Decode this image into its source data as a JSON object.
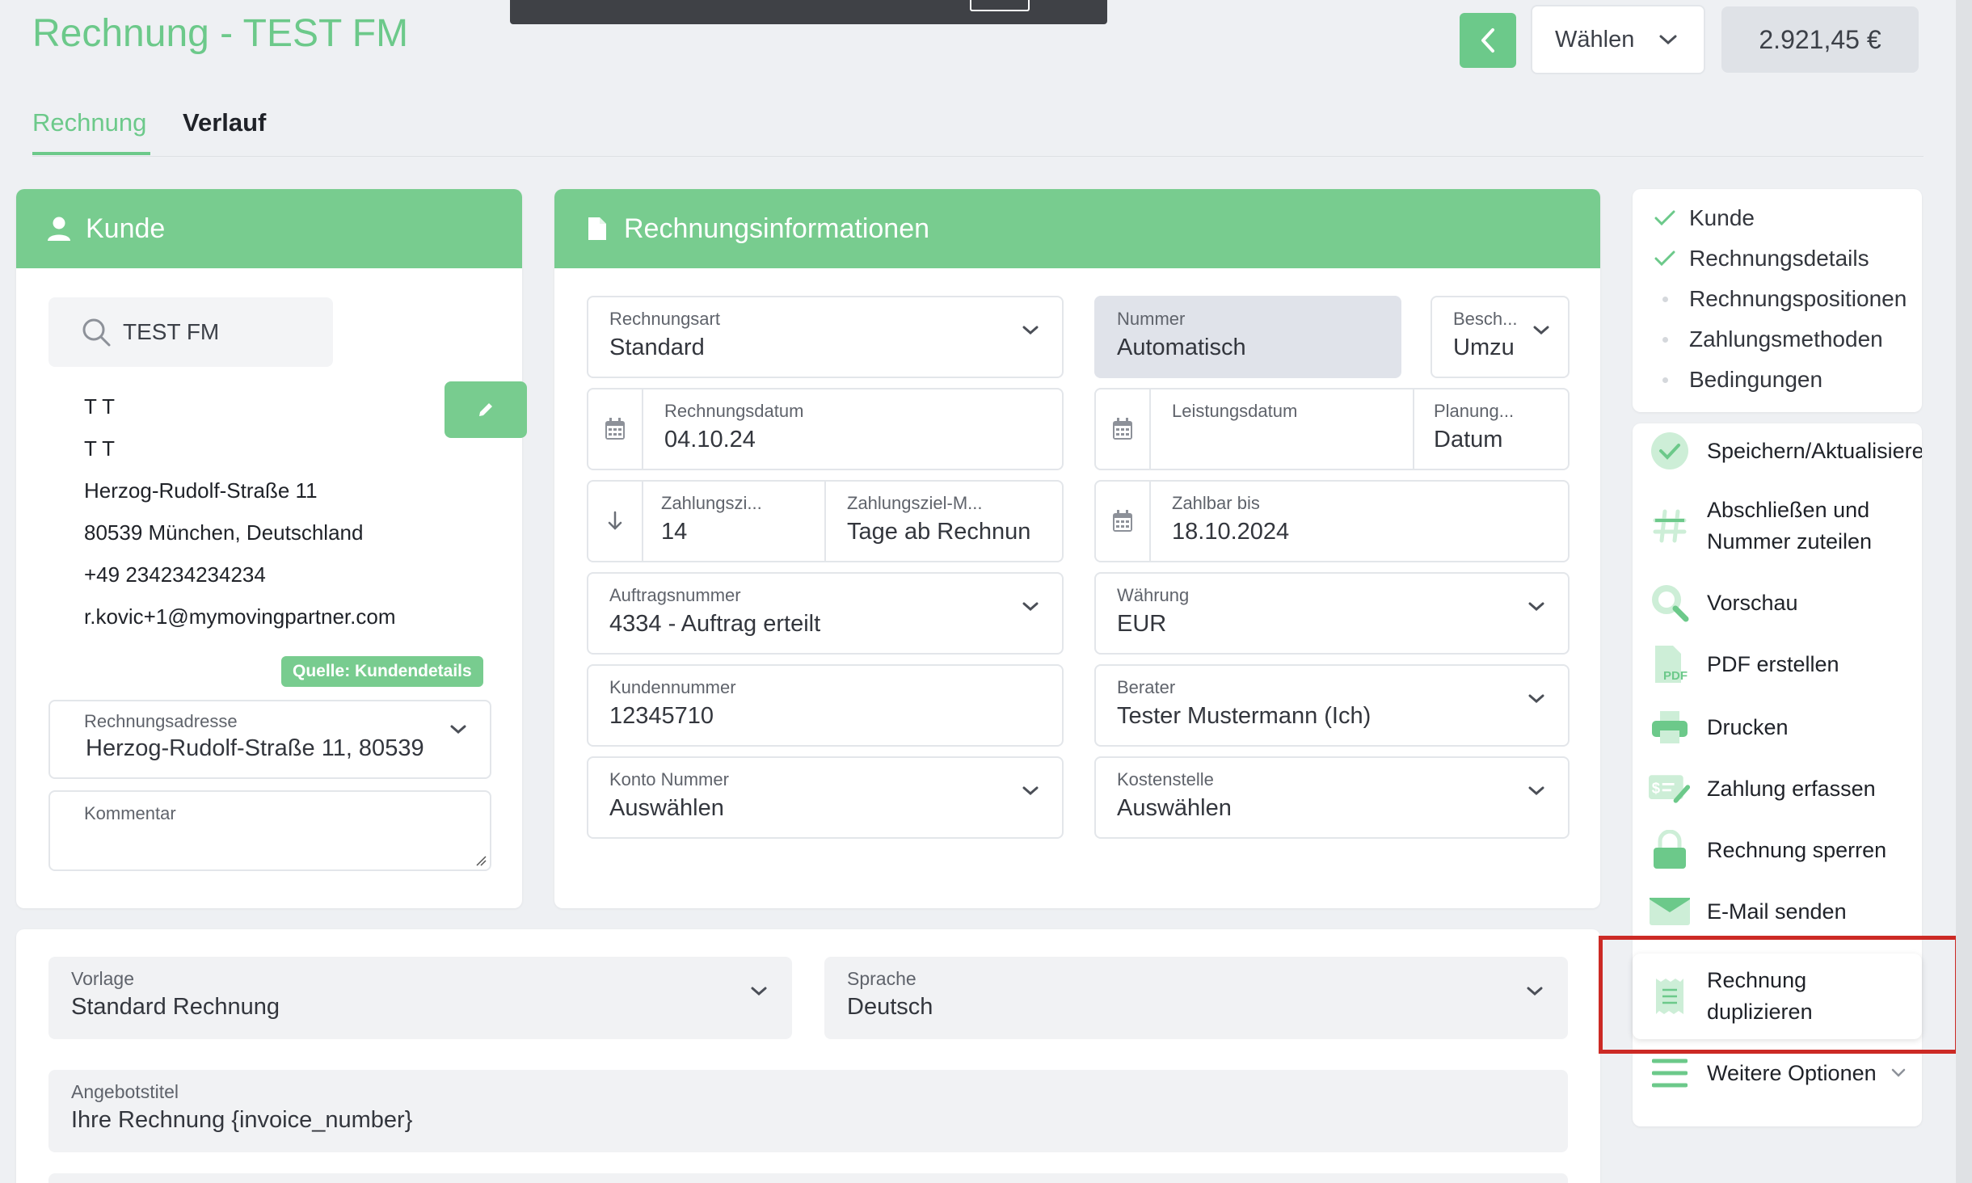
{
  "header": {
    "title": "Rechnung - TEST FM",
    "select_label": "Wählen",
    "total_amount": "2.921,45 €"
  },
  "tabs": [
    {
      "label": "Rechnung",
      "active": true
    },
    {
      "label": "Verlauf",
      "active": false
    }
  ],
  "kunde": {
    "title": "Kunde",
    "search_value": "TEST FM",
    "address_lines": [
      "T T",
      "T T",
      "Herzog-Rudolf-Straße 11",
      "80539 München, Deutschland",
      "+49 234234234234",
      "r.kovic+1@mymovingpartner.com"
    ],
    "source_badge": "Quelle: Kundendetails",
    "billing_address": {
      "label": "Rechnungsadresse",
      "value": "Herzog-Rudolf-Straße 11, 80539"
    },
    "comment": {
      "label": "Kommentar",
      "value": ""
    }
  },
  "rechnungsinfo": {
    "title": "Rechnungsinformationen",
    "rechnungsart": {
      "label": "Rechnungsart",
      "value": "Standard"
    },
    "nummer": {
      "label": "Nummer",
      "value": "Automatisch"
    },
    "beschreibung": {
      "label": "Besch...",
      "value": "Umzu"
    },
    "rechnungsdatum": {
      "label": "Rechnungsdatum",
      "value": "04.10.24"
    },
    "leistungsdatum": {
      "label": "Leistungsdatum",
      "value": ""
    },
    "planung": {
      "label": "Planung...",
      "value": "Datum"
    },
    "zahlungsziel": {
      "label": "Zahlungszi...",
      "value": "14"
    },
    "zahlungsziel_modus": {
      "label": "Zahlungsziel-M...",
      "value": "Tage ab Rechnun"
    },
    "zahlbar_bis": {
      "label": "Zahlbar bis",
      "value": "18.10.2024"
    },
    "auftragsnummer": {
      "label": "Auftragsnummer",
      "value": "4334 - Auftrag erteilt"
    },
    "waehrung": {
      "label": "Währung",
      "value": "EUR"
    },
    "kundennummer": {
      "label": "Kundennummer",
      "value": "12345710"
    },
    "berater": {
      "label": "Berater",
      "value": "Tester Mustermann (Ich)"
    },
    "konto": {
      "label": "Konto Nummer",
      "value": "Auswählen"
    },
    "kostenstelle": {
      "label": "Kostenstelle",
      "value": "Auswählen"
    }
  },
  "bottom": {
    "vorlage": {
      "label": "Vorlage",
      "value": "Standard Rechnung"
    },
    "sprache": {
      "label": "Sprache",
      "value": "Deutsch"
    },
    "angebotstitel": {
      "label": "Angebotstitel",
      "value": "Ihre Rechnung {invoice_number}"
    }
  },
  "steps": [
    {
      "label": "Kunde",
      "done": true
    },
    {
      "label": "Rechnungsdetails",
      "done": true
    },
    {
      "label": "Rechnungspositionen",
      "done": false
    },
    {
      "label": "Zahlungsmethoden",
      "done": false
    },
    {
      "label": "Bedingungen",
      "done": false
    }
  ],
  "actions": {
    "save": "Speichern/Aktualisieren",
    "finalize_line1": "Abschließen und",
    "finalize_line2": "Nummer zuteilen",
    "preview": "Vorschau",
    "pdf": "PDF erstellen",
    "print": "Drucken",
    "payment": "Zahlung erfassen",
    "lock": "Rechnung sperren",
    "email": "E-Mail senden",
    "duplicate_line1": "Rechnung",
    "duplicate_line2": "duplizieren",
    "more": "Weitere Optionen"
  },
  "colors": {
    "accent": "#6cc98a",
    "header_green": "#78cc8f",
    "highlight_red": "#cc2a25"
  }
}
